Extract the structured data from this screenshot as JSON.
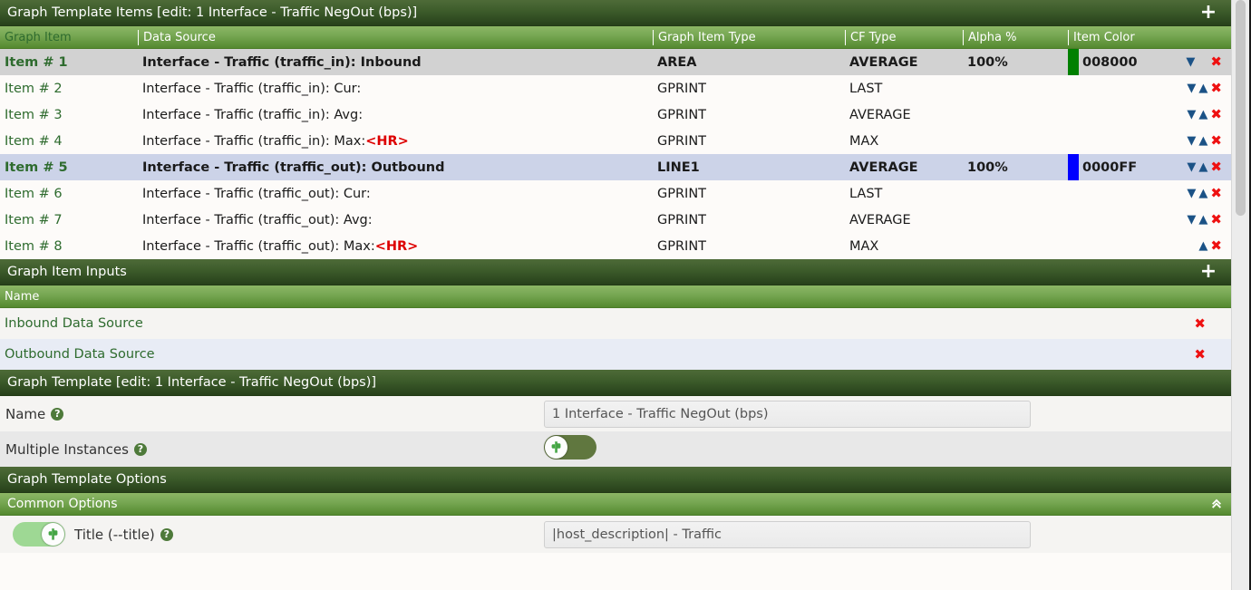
{
  "graph_template_items": {
    "section_title": "Graph Template Items [edit: 1 Interface - Traffic NegOut (bps)]",
    "add_label": "+",
    "columns": [
      "Graph Item",
      "Data Source",
      "Graph Item Type",
      "CF Type",
      "Alpha %",
      "Item Color"
    ],
    "rows": [
      {
        "item": "Item # 1",
        "data_source": "Interface - Traffic (traffic_in): Inbound",
        "data_source_tag": "",
        "graph_item_type": "AREA",
        "cf_type": "AVERAGE",
        "alpha": "100%",
        "color_hex": "008000",
        "color_value": "#008000",
        "bold": true,
        "highlight": "gray",
        "has_down": true,
        "has_up": false
      },
      {
        "item": "Item # 2",
        "data_source": "Interface - Traffic (traffic_in): Cur:",
        "data_source_tag": "",
        "graph_item_type": "GPRINT",
        "cf_type": "LAST",
        "alpha": "",
        "color_hex": "",
        "color_value": "",
        "bold": false,
        "highlight": "none",
        "has_down": true,
        "has_up": true
      },
      {
        "item": "Item # 3",
        "data_source": "Interface - Traffic (traffic_in): Avg:",
        "data_source_tag": "",
        "graph_item_type": "GPRINT",
        "cf_type": "AVERAGE",
        "alpha": "",
        "color_hex": "",
        "color_value": "",
        "bold": false,
        "highlight": "none",
        "has_down": true,
        "has_up": true
      },
      {
        "item": "Item # 4",
        "data_source": "Interface - Traffic (traffic_in): Max:",
        "data_source_tag": "<HR>",
        "graph_item_type": "GPRINT",
        "cf_type": "MAX",
        "alpha": "",
        "color_hex": "",
        "color_value": "",
        "bold": false,
        "highlight": "none",
        "has_down": true,
        "has_up": true
      },
      {
        "item": "Item # 5",
        "data_source": "Interface - Traffic (traffic_out): Outbound",
        "data_source_tag": "",
        "graph_item_type": "LINE1",
        "cf_type": "AVERAGE",
        "alpha": "100%",
        "color_hex": "0000FF",
        "color_value": "#0000FF",
        "bold": true,
        "highlight": "blue",
        "has_down": true,
        "has_up": true
      },
      {
        "item": "Item # 6",
        "data_source": "Interface - Traffic (traffic_out): Cur:",
        "data_source_tag": "",
        "graph_item_type": "GPRINT",
        "cf_type": "LAST",
        "alpha": "",
        "color_hex": "",
        "color_value": "",
        "bold": false,
        "highlight": "none",
        "has_down": true,
        "has_up": true
      },
      {
        "item": "Item # 7",
        "data_source": "Interface - Traffic (traffic_out): Avg:",
        "data_source_tag": "",
        "graph_item_type": "GPRINT",
        "cf_type": "AVERAGE",
        "alpha": "",
        "color_hex": "",
        "color_value": "",
        "bold": false,
        "highlight": "none",
        "has_down": true,
        "has_up": true
      },
      {
        "item": "Item # 8",
        "data_source": "Interface - Traffic (traffic_out): Max:",
        "data_source_tag": "<HR>",
        "graph_item_type": "GPRINT",
        "cf_type": "MAX",
        "alpha": "",
        "color_hex": "",
        "color_value": "",
        "bold": false,
        "highlight": "none",
        "has_down": false,
        "has_up": true
      }
    ]
  },
  "graph_item_inputs": {
    "section_title": "Graph Item Inputs",
    "add_label": "+",
    "column_name": "Name",
    "rows": [
      {
        "name": "Inbound Data Source"
      },
      {
        "name": "Outbound Data Source"
      }
    ]
  },
  "graph_template": {
    "section_title": "Graph Template [edit: 1 Interface - Traffic NegOut (bps)]",
    "fields": [
      {
        "label": "Name",
        "type": "text",
        "value": "1 Interface - Traffic NegOut (bps)",
        "placeholder": ""
      },
      {
        "label": "Multiple Instances",
        "type": "toggle",
        "state": "off"
      }
    ]
  },
  "graph_template_options": {
    "section_title": "Graph Template Options",
    "common_options": {
      "title": "Common Options",
      "collapse_icon": "chevron-double-up"
    },
    "title_option": {
      "toggle_state": "on",
      "label": "Title (--title)",
      "value": "|host_description| - Traffic"
    }
  },
  "icons": {
    "help": "?",
    "delete": "✖",
    "move_down": "▼",
    "move_up": "▲",
    "collapse": "«"
  }
}
